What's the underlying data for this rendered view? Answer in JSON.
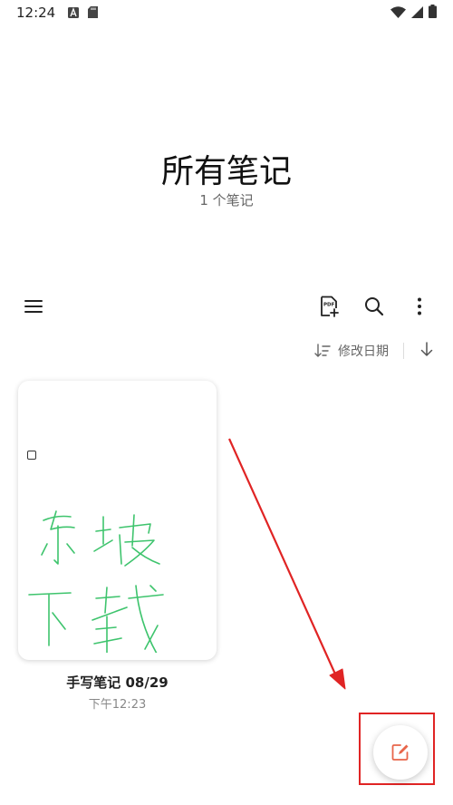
{
  "status_bar": {
    "time": "12:24",
    "icons": [
      "a-notification-icon",
      "sd-card-icon",
      "wifi-icon",
      "signal-icon",
      "battery-icon"
    ]
  },
  "header": {
    "title": "所有笔记",
    "subtitle": "1 个笔记"
  },
  "toolbar": {
    "icons": [
      "menu-icon",
      "import-pdf-icon",
      "search-icon",
      "more-vertical-icon"
    ]
  },
  "sort": {
    "label": "修改日期"
  },
  "notes": [
    {
      "title": "手写笔记 08/29",
      "time": "下午12:23",
      "handwriting_color": "#3ec46d"
    }
  ],
  "colors": {
    "accent": "#e8654a",
    "annotation_red": "#e02424"
  }
}
